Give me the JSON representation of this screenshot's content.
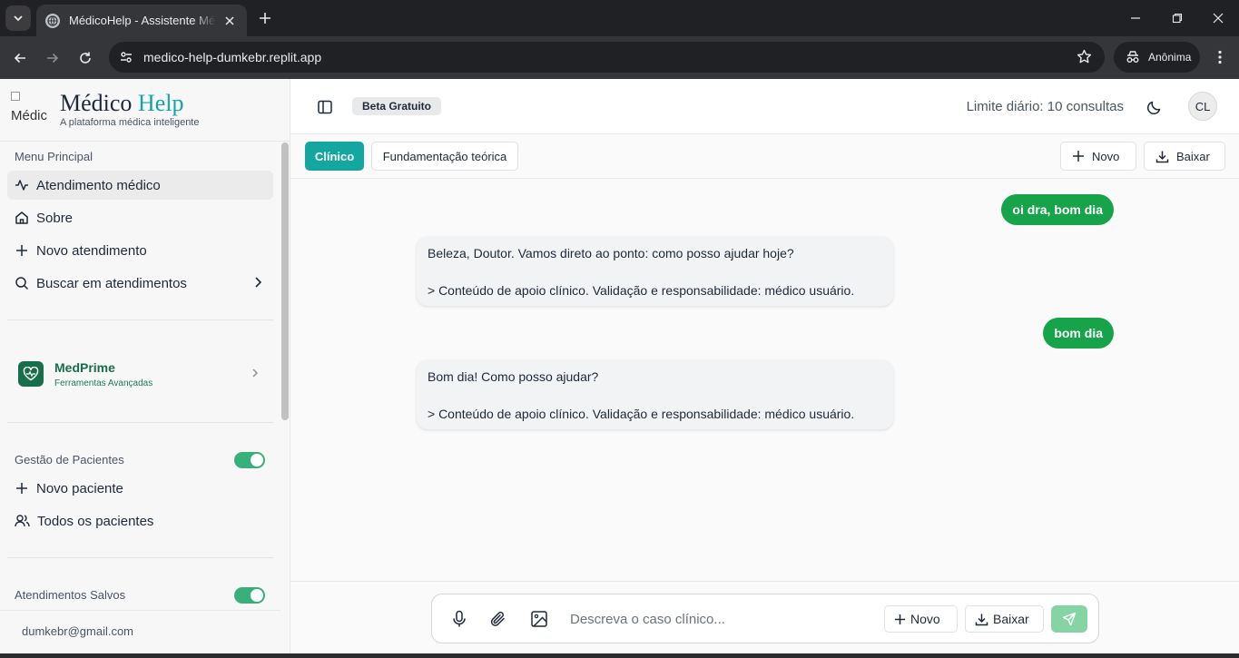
{
  "browser": {
    "tab_title": "MédicoHelp - Assistente Médico Inteligente",
    "url": "medico-help-dumkebr.replit.app",
    "profile_label": "Anônima"
  },
  "brand": {
    "logo_alt": "Médic",
    "name_part1": "Médico",
    "name_part2": "Help",
    "tagline": "A plataforma médica inteligente"
  },
  "sidebar": {
    "menu_label": "Menu Principal",
    "items": [
      {
        "label": "Atendimento médico",
        "icon": "activity-icon"
      },
      {
        "label": "Sobre",
        "icon": "home-icon"
      },
      {
        "label": "Novo atendimento",
        "icon": "plus-icon"
      },
      {
        "label": "Buscar em atendimentos",
        "icon": "search-icon"
      }
    ],
    "medprime": {
      "title": "MedPrime",
      "subtitle": "Ferramentas Avançadas"
    },
    "patients": {
      "label": "Gestão de Pacientes",
      "toggle_on": true,
      "items": [
        {
          "label": "Novo paciente",
          "icon": "plus-icon"
        },
        {
          "label": "Todos os pacientes",
          "icon": "users-icon"
        }
      ]
    },
    "saved": {
      "label": "Atendimentos Salvos",
      "toggle_on": true
    },
    "email": "dumkebr@gmail.com"
  },
  "header": {
    "badge": "Beta Gratuito",
    "limit": "Limite diário: 10 consultas",
    "avatar_initials": "CL"
  },
  "toolbar": {
    "tab_clinico": "Clínico",
    "tab_fundamentacao": "Fundamentação teórica",
    "novo": "Novo",
    "baixar": "Baixar"
  },
  "messages": [
    {
      "role": "user",
      "text": "oi dra, bom dia"
    },
    {
      "role": "assistant",
      "line1": "Beleza, Doutor. Vamos direto ao ponto: como posso ajudar hoje?",
      "line2": "> Conteúdo de apoio clínico. Validação e responsabilidade: médico usuário."
    },
    {
      "role": "user",
      "text": "bom dia"
    },
    {
      "role": "assistant",
      "line1": "Bom dia! Como posso ajudar?",
      "line2": "> Conteúdo de apoio clínico. Validação e responsabilidade: médico usuário."
    }
  ],
  "composer": {
    "placeholder": "Descreva o caso clínico...",
    "novo": "Novo",
    "baixar": "Baixar"
  },
  "colors": {
    "accent_teal": "#14a6a1",
    "user_bubble": "#16a34a",
    "toggle_green": "#37b07a",
    "medprime_green": "#166e4a"
  }
}
